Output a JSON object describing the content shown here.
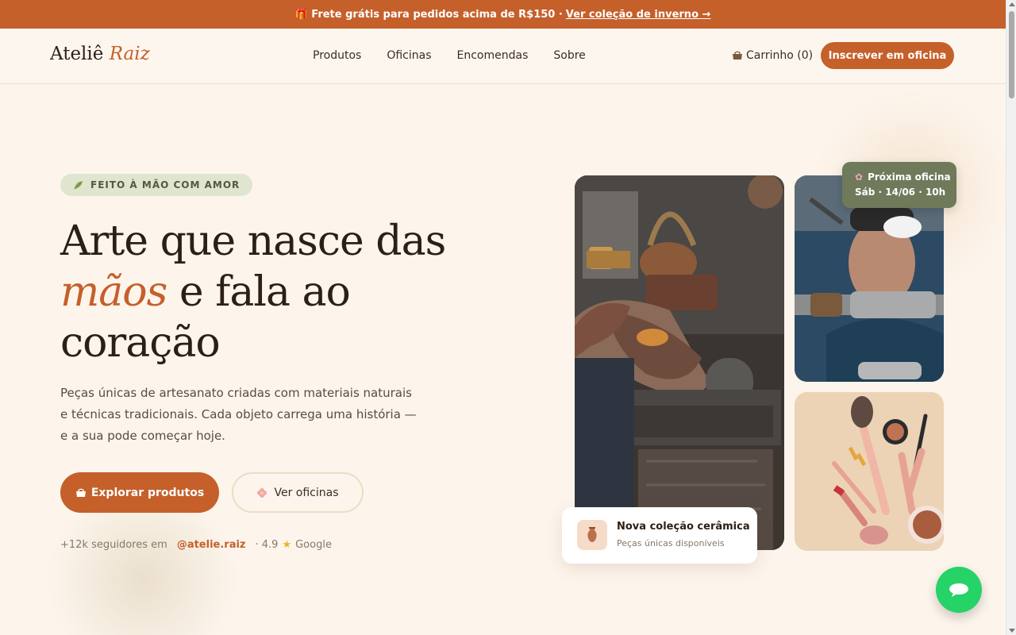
{
  "announcement": {
    "text": "🎁 Frete grátis para pedidos acima de R$150 ·",
    "link": "Ver coleção de inverno →"
  },
  "header": {
    "logo_main": "Ateliê",
    "logo_accent": "Raiz",
    "nav": [
      "Produtos",
      "Oficinas",
      "Encomendas",
      "Sobre"
    ],
    "cart_label": "Carrinho (0)",
    "cta_label": "Inscrever em oficina"
  },
  "hero": {
    "badge": "FEITO À MÃO COM AMOR",
    "title_line1": "Arte que nasce das",
    "title_accent": "mãos",
    "title_rest": " e fala ao",
    "title_line3": "coração",
    "description": "Peças únicas de artesanato criadas com materiais naturais e técnicas tradicionais. Cada objeto carrega uma história — e a sua pode começar hoje.",
    "primary_button": "Explorar produtos",
    "secondary_button": "Ver oficinas",
    "social_followers": "+12k seguidores em",
    "social_handle": "@atelie.raiz",
    "social_rating_prefix": "· 4.9",
    "social_rating_source": "Google"
  },
  "gallery": {
    "workshop_card_title": "Próxima oficina",
    "workshop_card_date": "Sáb · 14/06 · 10h",
    "collection_title": "Nova coleção cerâmica",
    "collection_subtitle": "Peças únicas disponíveis"
  },
  "colors": {
    "accent": "#c5602b",
    "background": "#fdf5ec",
    "badge_bg": "#dfe5cf",
    "workshop_card": "#6e7a5a",
    "whatsapp": "#25d366"
  }
}
